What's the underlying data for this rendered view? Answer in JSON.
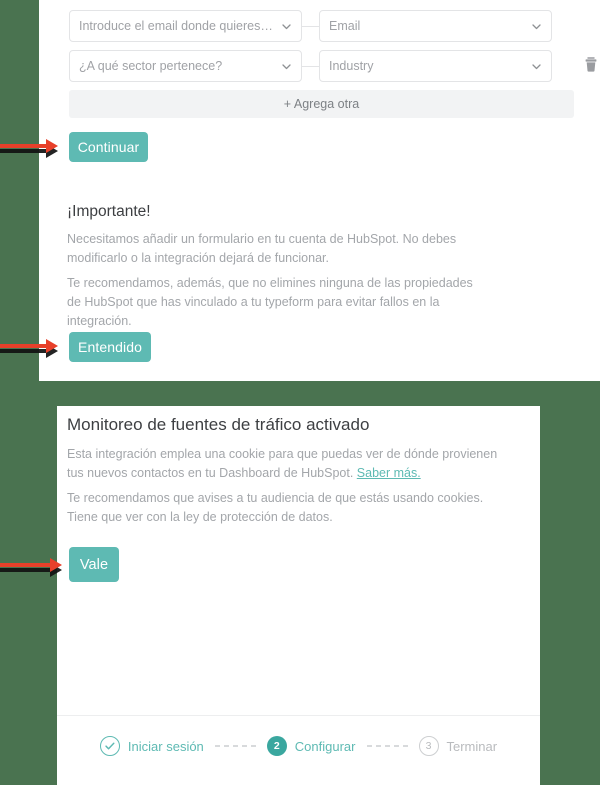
{
  "theme": {
    "page_background": "#4a7350",
    "panel_background": "#ffffff",
    "accent_teal": "#5ebab3",
    "accent_teal_dark": "#3aa79f",
    "annotation_arrow": "#e8402a",
    "muted_text": "#a3a6aa",
    "heading_text": "#3d3f42"
  },
  "panel_top": {
    "mapping_rows": [
      {
        "source": {
          "value": "Introduce el email donde quieres recibir l...",
          "icon": "chevron-down-icon"
        },
        "target": {
          "value": "Email",
          "icon": "chevron-down-icon"
        },
        "has_delete": false
      },
      {
        "source": {
          "value": "¿A qué sector pertenece?",
          "icon": "chevron-down-icon"
        },
        "target": {
          "value": "Industry",
          "icon": "chevron-down-icon"
        },
        "has_delete": true,
        "delete_icon": "trash-icon"
      }
    ],
    "add_another_label": "+ Agrega otra",
    "continue_label": "Continuar",
    "important": {
      "title": "¡Importante!",
      "paragraph_1": "Necesitamos añadir un formulario en tu cuenta de HubSpot. No debes modificarlo o la integración dejará de funcionar.",
      "paragraph_2": "Te recomendamos, además, que no elimines ninguna de las propiedades de HubSpot que has vinculado a tu typeform para evitar fallos en la integración.",
      "acknowledge_label": "Entendido"
    }
  },
  "panel_bottom": {
    "title": "Monitoreo de fuentes de tráfico activado",
    "paragraph_1_before_link": "Esta integración emplea una cookie para que puedas ver de dónde provienen tus nuevos contactos en tu Dashboard de HubSpot. ",
    "paragraph_1_link": "Saber más.",
    "paragraph_2": "Te recomendamos que avises a tu audiencia de que estás usando cookies. Tiene que ver con la ley de protección de datos.",
    "confirm_label": "Vale",
    "stepper": [
      {
        "number": "",
        "label": "Iniciar sesión",
        "state": "done",
        "icon": "check-circle-icon"
      },
      {
        "number": "2",
        "label": "Configurar",
        "state": "active",
        "icon": ""
      },
      {
        "number": "3",
        "label": "Terminar",
        "state": "todo",
        "icon": ""
      }
    ]
  },
  "annotations": [
    {
      "name": "arrow-to-continuar",
      "points_to": "Continuar"
    },
    {
      "name": "arrow-to-entendido",
      "points_to": "Entendido"
    },
    {
      "name": "arrow-to-vale",
      "points_to": "Vale"
    }
  ]
}
